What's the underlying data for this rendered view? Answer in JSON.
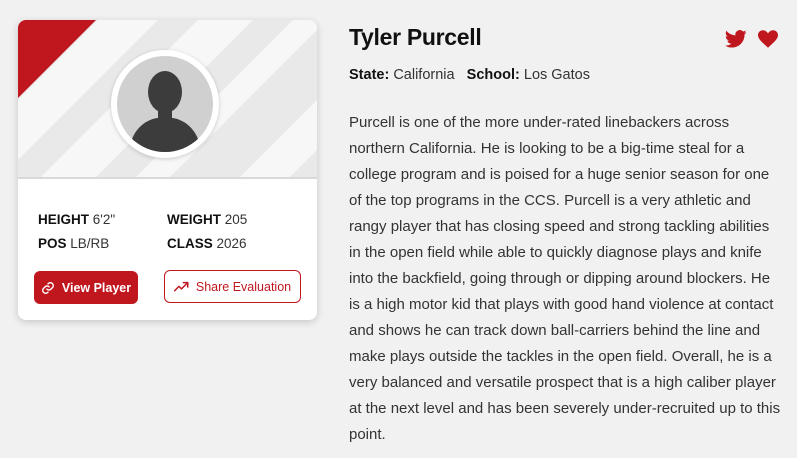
{
  "player": {
    "name": "Tyler Purcell",
    "state_label": "State:",
    "state": "California",
    "school_label": "School:",
    "school": "Los Gatos",
    "bio": "Purcell is one of the more under-rated linebackers across northern California. He is looking to be a big-time steal for a college program and is poised for a huge senior season for one of the top programs in the CCS. Purcell is a very athletic and rangy player that has closing speed and strong tackling abilities in the open field while able to quickly diagnose plays and knife into the backfield, going through or dipping around blockers. He is a high motor kid that plays with good hand violence at contact and shows he can track down ball-carriers behind the line and make plays outside the tackles in the open field. Overall, he is a very balanced and versatile prospect that is a high caliber player at the next level and has been severely under-recruited up to this point."
  },
  "stats": {
    "height_label": "HEIGHT",
    "height": "6'2\"",
    "weight_label": "WEIGHT",
    "weight": "205",
    "pos_label": "POS",
    "pos": "LB/RB",
    "class_label": "CLASS",
    "class": "2026"
  },
  "actions": {
    "view_player": "View Player",
    "share_evaluation": "Share Evaluation"
  },
  "icons": {
    "link": "link-icon",
    "trend": "trending-up-icon",
    "twitter": "twitter-icon",
    "favorite": "heart-icon",
    "avatar": "user-silhouette-icon"
  },
  "colors": {
    "accent": "#c0171f",
    "background": "#f1f1f1"
  }
}
